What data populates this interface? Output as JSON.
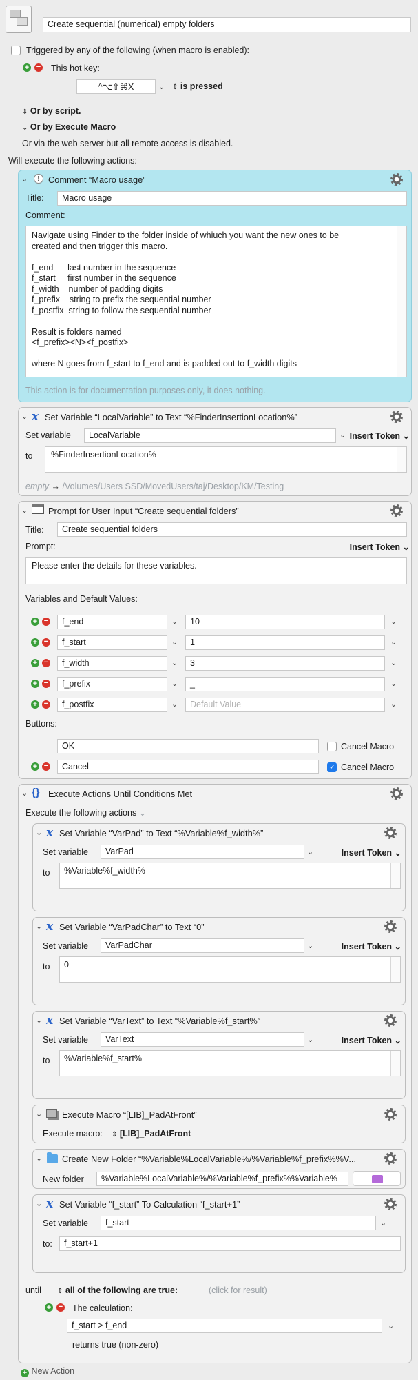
{
  "macro": {
    "name": "Create sequential (numerical) empty folders"
  },
  "trigger": {
    "triggered_label": "Triggered by any of the following (when macro is enabled):",
    "hotkey_label": "This hot key:",
    "hotkey_value": "^⌥⇧⌘X",
    "hotkey_state": "is pressed",
    "by_script": "Or by script.",
    "by_execute": "Or by Execute Macro",
    "web_note": "Or via the web server but all remote access is disabled."
  },
  "will_execute": "Will execute the following actions:",
  "comment_action": {
    "header": "Comment “Macro usage”",
    "title_label": "Title:",
    "title_value": "Macro usage",
    "comment_label": "Comment:",
    "lines": [
      "Navigate using Finder to the folder inside of whiuch you want the new ones to be",
      "created and then trigger this macro.",
      "",
      "f_end      last number in the sequence",
      "f_start     first number in the sequence",
      "f_width    number of padding digits",
      "f_prefix    string to prefix the sequential number",
      "f_postfix  string to follow the sequential number",
      "",
      "Result is folders named",
      "<f_prefix><N><f_postfix>",
      "",
      "where N goes from f_start to f_end and is padded out to f_width digits"
    ],
    "footer": "This action is for documentation purposes only, it does nothing."
  },
  "set_local": {
    "header": "Set Variable “LocalVariable” to Text “%FinderInsertionLocation%”",
    "set_label": "Set variable",
    "variable": "LocalVariable",
    "insert_token": "Insert Token",
    "to_label": "to",
    "value": "%FinderInsertionLocation%",
    "preview_empty": "empty",
    "preview_arrow": "→",
    "preview_path": "/Volumes/Users SSD/MovedUsers/taj/Desktop/KM/Testing"
  },
  "prompt": {
    "header": "Prompt for User Input “Create sequential folders”",
    "title_label": "Title:",
    "title_value": "Create sequential folders",
    "prompt_label": "Prompt:",
    "insert_token": "Insert Token",
    "prompt_value": "Please enter the details for these variables.",
    "vars_label": "Variables and Default Values:",
    "variables": [
      {
        "name": "f_end",
        "value": "10"
      },
      {
        "name": "f_start",
        "value": "1"
      },
      {
        "name": "f_width",
        "value": "3"
      },
      {
        "name": "f_prefix",
        "value": "_"
      },
      {
        "name": "f_postfix",
        "value": ""
      }
    ],
    "default_placeholder": "Default Value",
    "buttons_label": "Buttons:",
    "buttons": [
      {
        "label": "OK",
        "cancel_label": "Cancel Macro",
        "cancel": false
      },
      {
        "label": "Cancel",
        "cancel_label": "Cancel Macro",
        "cancel": true
      }
    ]
  },
  "until_action": {
    "header": "Execute Actions Until Conditions Met",
    "execute_label": "Execute the following actions",
    "subactions": {
      "varpad": {
        "header": "Set Variable “VarPad” to Text “%Variable%f_width%”",
        "set_label": "Set variable",
        "variable": "VarPad",
        "insert_token": "Insert Token",
        "to_label": "to",
        "value": "%Variable%f_width%"
      },
      "varpadchar": {
        "header": "Set Variable “VarPadChar” to Text “0”",
        "set_label": "Set variable",
        "variable": "VarPadChar",
        "insert_token": "Insert Token",
        "to_label": "to",
        "value": "0"
      },
      "vartext": {
        "header": "Set Variable “VarText” to Text “%Variable%f_start%”",
        "set_label": "Set variable",
        "variable": "VarText",
        "insert_token": "Insert Token",
        "to_label": "to",
        "value": "%Variable%f_start%"
      },
      "execmacro": {
        "header": "Execute Macro “[LIB]_PadAtFront”",
        "label": "Execute macro:",
        "value": "[LIB]_PadAtFront"
      },
      "newfolder": {
        "header": "Create New Folder “%Variable%LocalVariable%/%Variable%f_prefix%%V...",
        "label": "New folder",
        "value": "%Variable%LocalVariable%/%Variable%f_prefix%%Variable%"
      },
      "calc": {
        "header": "Set Variable “f_start” To Calculation “f_start+1”",
        "set_label": "Set variable",
        "variable": "f_start",
        "to_label": "to:",
        "value": "f_start+1"
      }
    },
    "until_label": "until",
    "condition_mode": "all of the following are true:",
    "click_result": "(click for result)",
    "calc_label": "The calculation:",
    "calc_value": "f_start > f_end",
    "returns": "returns true (non-zero)"
  },
  "new_action": "New Action",
  "colors": {
    "comment_bg": "#b3e6f0",
    "accent_blue": "#2a63c9",
    "plus": "#3a9e3a",
    "minus": "#d9342b"
  }
}
